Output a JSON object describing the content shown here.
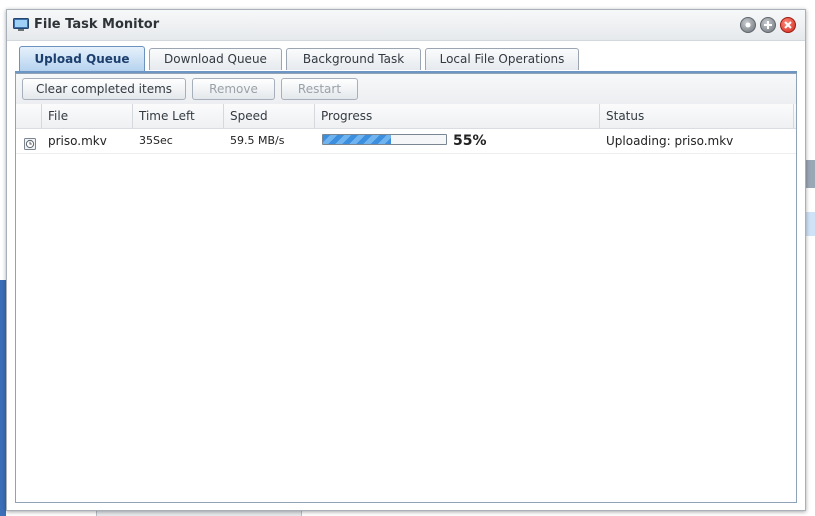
{
  "window": {
    "title": "File Task Monitor"
  },
  "icons": {
    "app": "monitor-icon",
    "minimize": "minimize-icon",
    "maximize": "maximize-icon",
    "close": "close-icon",
    "row_status": "clock-icon"
  },
  "tabs": [
    {
      "label": "Upload Queue",
      "active": true
    },
    {
      "label": "Download Queue",
      "active": false
    },
    {
      "label": "Background Task",
      "active": false
    },
    {
      "label": "Local File Operations",
      "active": false
    }
  ],
  "toolbar": {
    "clear_label": "Clear completed items",
    "remove_label": "Remove",
    "restart_label": "Restart"
  },
  "columns": [
    "File",
    "Time Left",
    "Speed",
    "Progress",
    "Status"
  ],
  "rows": [
    {
      "file": "priso.mkv",
      "time_left": "35Sec",
      "speed": "59.5 MB/s",
      "progress": 55,
      "progress_label": "55%",
      "status": "Uploading: priso.mkv"
    }
  ],
  "colors": {
    "accent": "#6d96c4",
    "progress": "#3c8fde",
    "close": "#d0261a"
  }
}
